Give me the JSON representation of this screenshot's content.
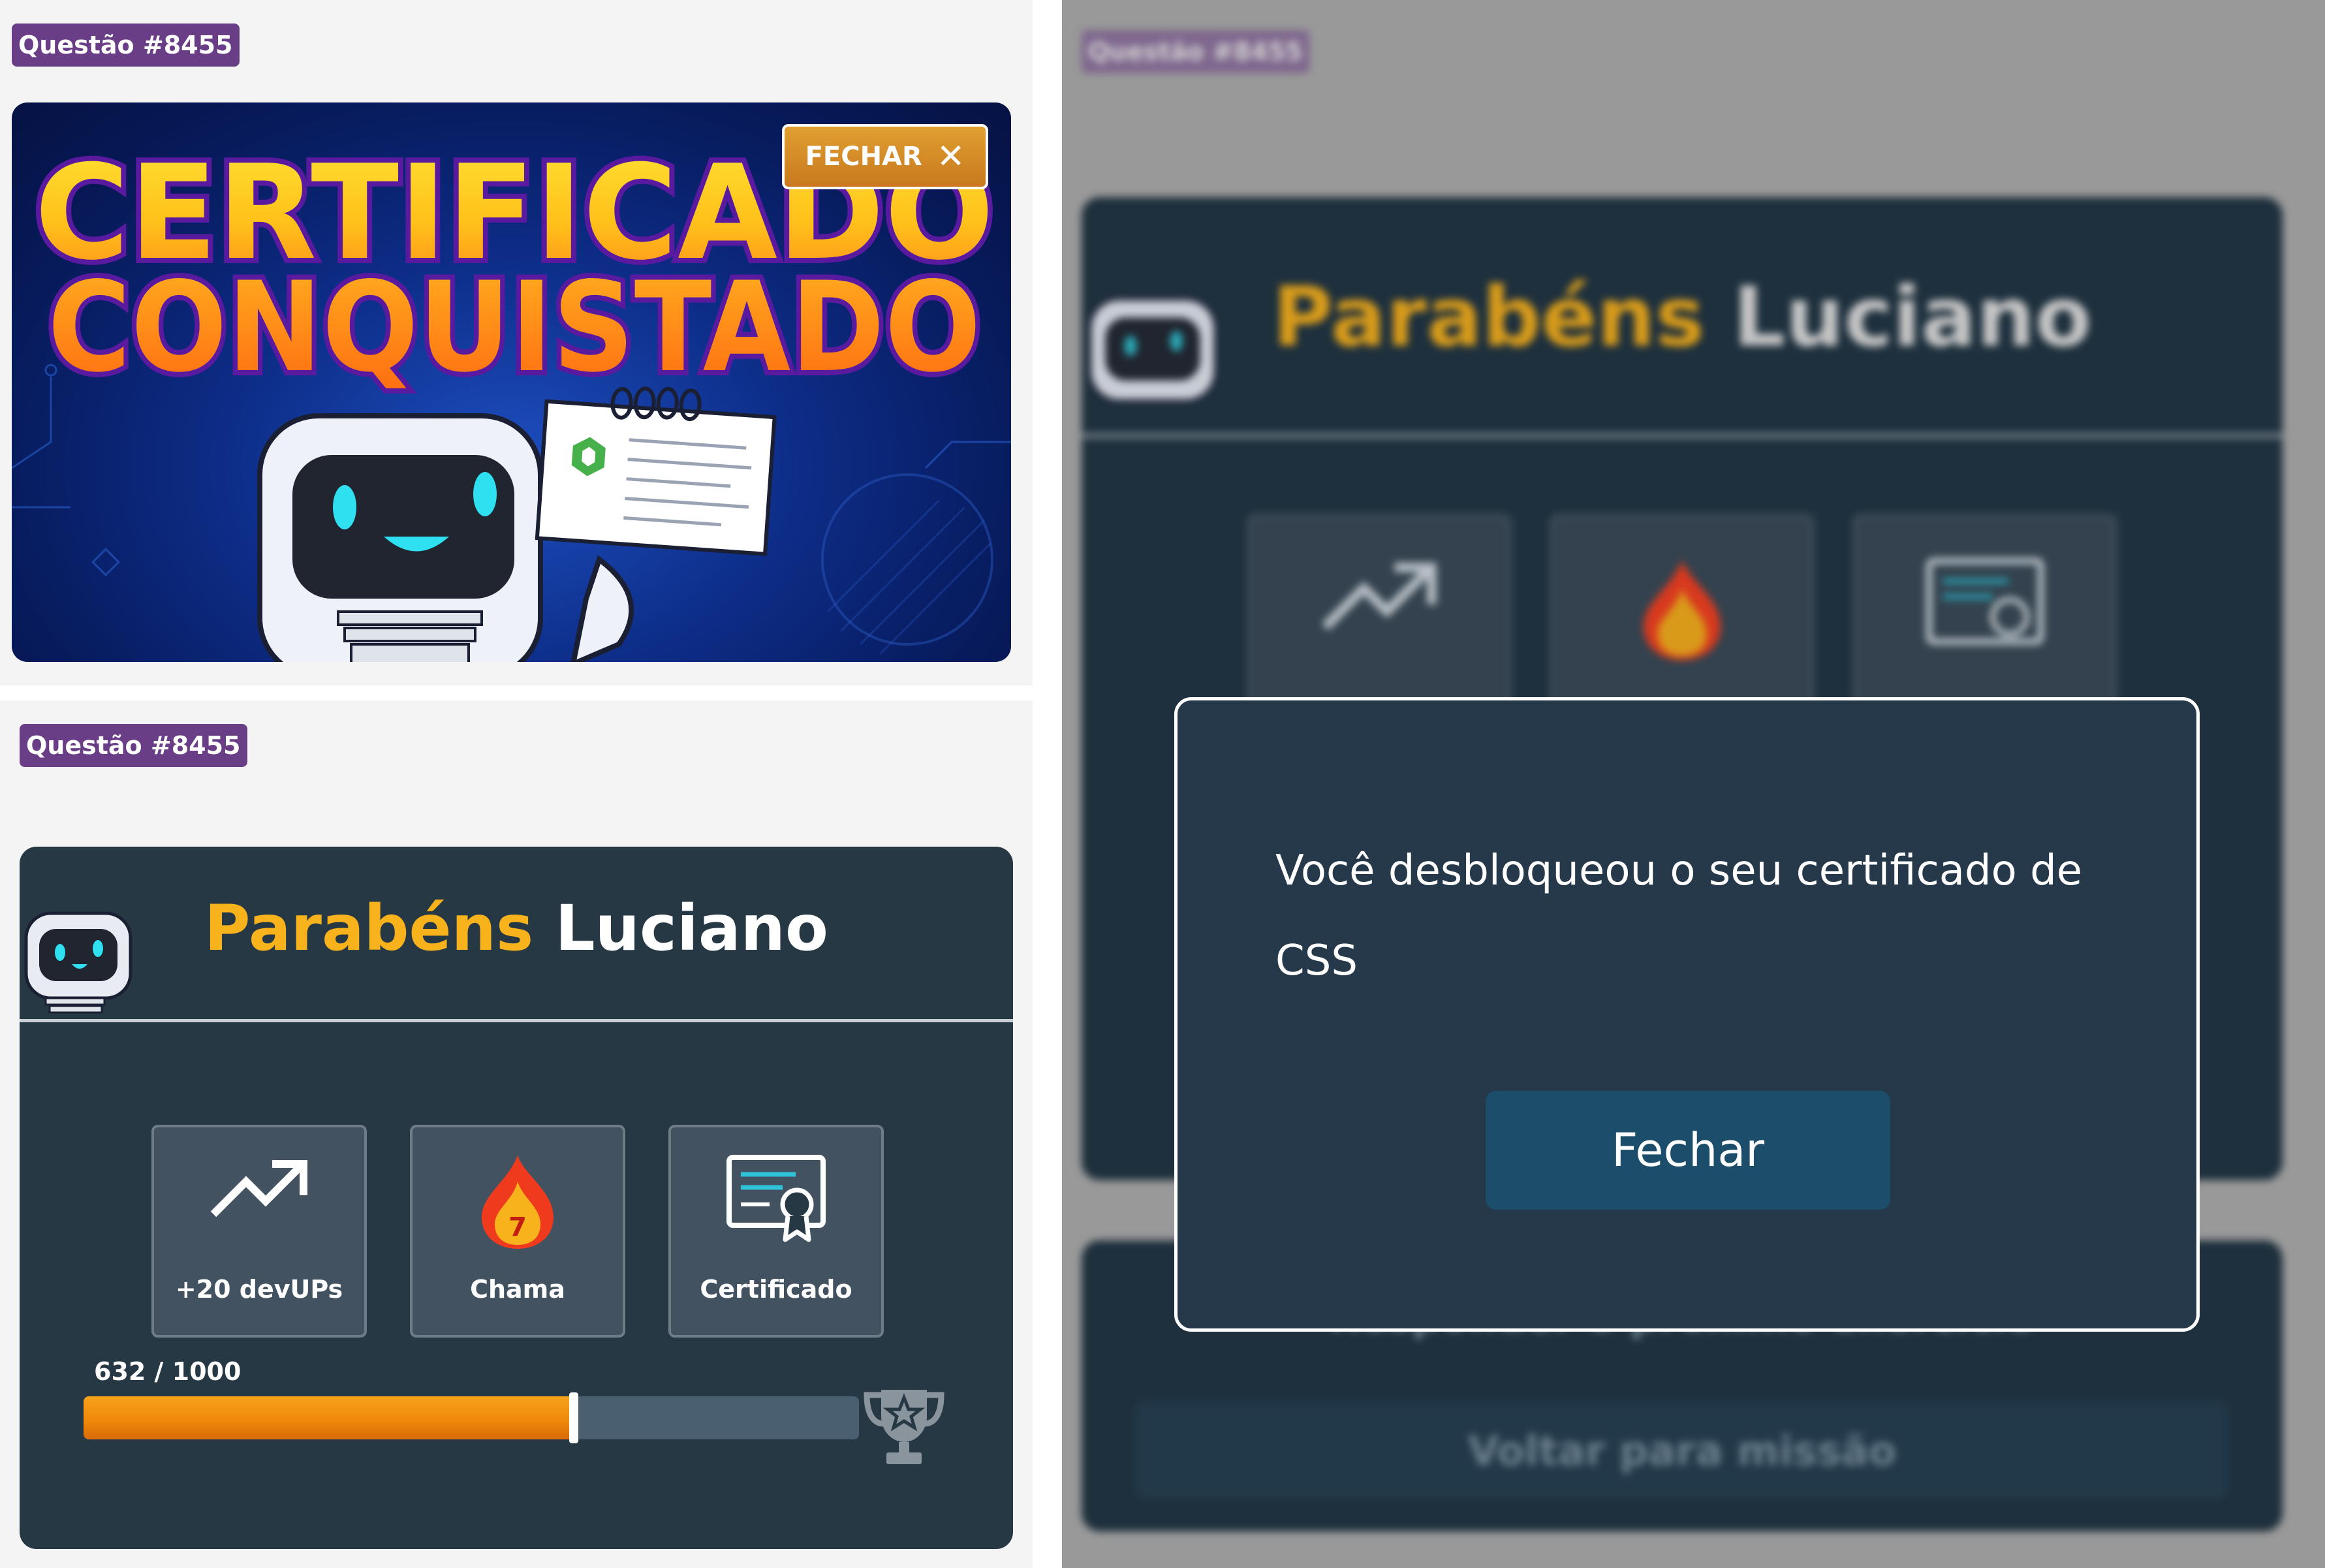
{
  "question_badge": "Questão #8455",
  "banner": {
    "headline_line1": "CERTIFICADO",
    "headline_line2": "CONQUISTADO",
    "close_label": "FECHAR"
  },
  "result_card": {
    "greeting": "Parabéns",
    "user_name": "Luciano",
    "rewards": [
      {
        "icon": "trending-up-icon",
        "label": "+20 devUPs"
      },
      {
        "icon": "flame-icon",
        "label": "Chama",
        "flame_count": "7"
      },
      {
        "icon": "certificate-icon",
        "label": "Certificado"
      }
    ],
    "progress": {
      "text": "632 / 1000",
      "current": 632,
      "total": 1000
    },
    "trophy_icon": "trophy-icon"
  },
  "background_card": {
    "next_exercise_label": "Responder o próximo exercício",
    "back_label": "Voltar para missão"
  },
  "modal": {
    "message": "Você desbloqueou o seu certificado de CSS",
    "button_label": "Fechar"
  },
  "colors": {
    "badge_purple": "#6a3e86",
    "card_bg": "#273845",
    "accent_yellow": "#f7b21c",
    "progress_orange": "#f08a0c",
    "modal_button": "#1c4d6b"
  }
}
